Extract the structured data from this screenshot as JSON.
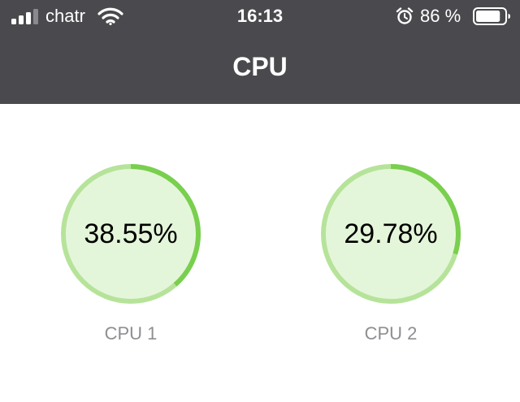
{
  "status_bar": {
    "carrier": "chatr",
    "time": "16:13",
    "battery_percent": "86 %",
    "battery_level": 0.86,
    "signal_bars": 3,
    "icons": [
      "signal-icon",
      "wifi-icon",
      "alarm-clock-icon",
      "battery-icon"
    ]
  },
  "header": {
    "title": "CPU"
  },
  "gauges": [
    {
      "label": "CPU 1",
      "value_text": "38.55%",
      "value": 38.55
    },
    {
      "label": "CPU 2",
      "value_text": "29.78%",
      "value": 29.78
    }
  ],
  "colors": {
    "header_bg": "#4a494d",
    "gauge_track": "#b6e39a",
    "gauge_fill": "#79cf4e",
    "gauge_inner": "#e4f6d9",
    "label_text": "#8e8e93"
  }
}
